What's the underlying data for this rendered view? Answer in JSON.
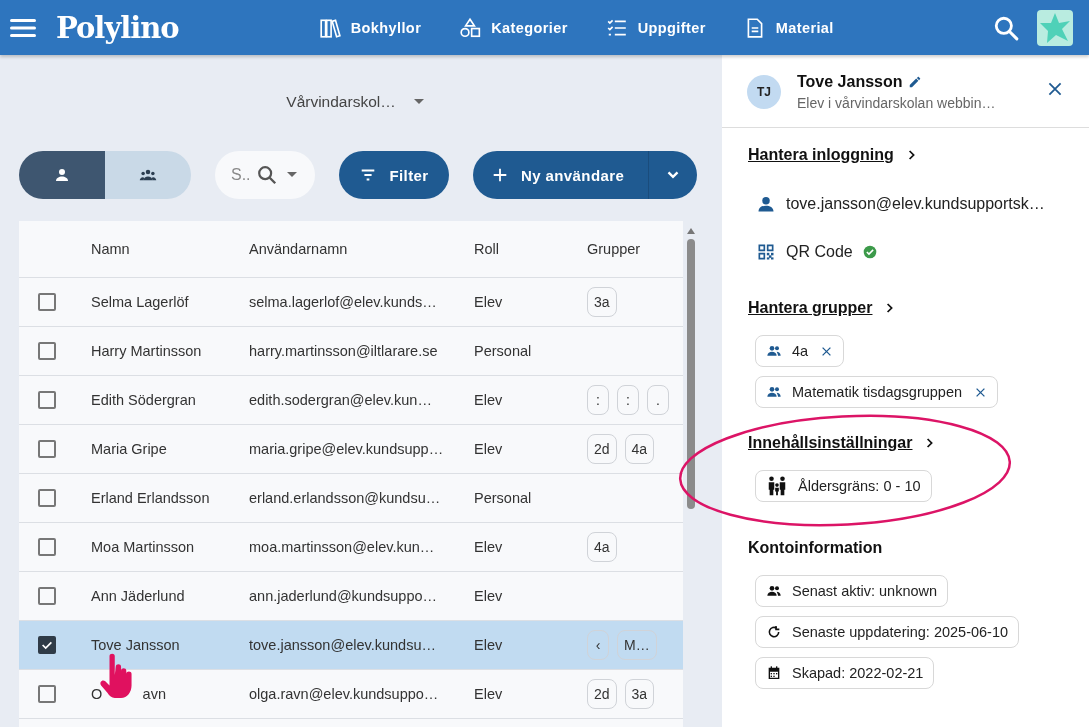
{
  "header": {
    "logo": "Polylino",
    "nav": [
      {
        "label": "Bokhyllor",
        "kind": "books"
      },
      {
        "label": "Kategorier",
        "kind": "shapes"
      },
      {
        "label": "Uppgifter",
        "kind": "checklist"
      },
      {
        "label": "Material",
        "kind": "document"
      }
    ]
  },
  "school_select": {
    "value": "Vårvindarskol…"
  },
  "view_toggle": [
    {
      "kind": "user",
      "selected": true
    },
    {
      "kind": "group",
      "selected": false
    }
  ],
  "search": {
    "placeholder": "S.."
  },
  "filter_button": "Filter",
  "new_user_button": "Ny användare",
  "table": {
    "columns": [
      "Namn",
      "Användarnamn",
      "Roll",
      "Grupper"
    ],
    "rows": [
      {
        "checked": false,
        "selected": false,
        "name": "Selma Lagerlöf",
        "username": "selma.lagerlof@elev.kunds…",
        "role": "Elev",
        "groups": [
          "3a"
        ]
      },
      {
        "checked": false,
        "selected": false,
        "name": "Harry Martinsson",
        "username": "harry.martinsson@iltlarare.se",
        "role": "Personal",
        "groups": []
      },
      {
        "checked": false,
        "selected": false,
        "name": "Edith Södergran",
        "username": "edith.sodergran@elev.kun…",
        "role": "Elev",
        "groups": [
          ":",
          ":",
          "."
        ]
      },
      {
        "checked": false,
        "selected": false,
        "name": "Maria Gripe",
        "username": "maria.gripe@elev.kundsupp…",
        "role": "Elev",
        "groups": [
          "2d",
          "4a"
        ]
      },
      {
        "checked": false,
        "selected": false,
        "name": "Erland Erlandsson",
        "username": "erland.erlandsson@kundsu…",
        "role": "Personal",
        "groups": []
      },
      {
        "checked": false,
        "selected": false,
        "name": "Moa Martinsson",
        "username": "moa.martinsson@elev.kun…",
        "role": "Elev",
        "groups": [
          "4a"
        ]
      },
      {
        "checked": false,
        "selected": false,
        "name": "Ann Jäderlund",
        "username": "ann.jaderlund@kundsuppo…",
        "role": "Elev",
        "groups": []
      },
      {
        "checked": true,
        "selected": true,
        "name": "Tove Jansson",
        "username": "tove.jansson@elev.kundsu…",
        "role": "Elev",
        "groups": [
          "‹",
          "M…"
        ]
      },
      {
        "checked": false,
        "selected": false,
        "name": "O          avn",
        "username": "olga.ravn@elev.kundsuppo…",
        "role": "Elev",
        "groups": [
          "2d",
          "3a"
        ]
      }
    ]
  },
  "panel": {
    "initials": "TJ",
    "name": "Tove Jansson",
    "subtitle": "Elev i vårvindarskolan webbin…",
    "login": {
      "heading": "Hantera inloggning",
      "username": "tove.jansson@elev.kundsupportsk…",
      "qr_label": "QR Code",
      "qr_verified": true
    },
    "groups": {
      "heading": "Hantera grupper",
      "chips": [
        "4a",
        "Matematik tisdagsgruppen"
      ]
    },
    "content": {
      "heading": "Innehållsinställningar",
      "chips": [
        "Åldersgräns: 0 - 10"
      ]
    },
    "account": {
      "heading": "Kontoinformation",
      "chips": [
        {
          "kind": "activity",
          "label": "Senast aktiv: unknown"
        },
        {
          "kind": "update",
          "label": "Senaste uppdatering: 2025-06-10"
        },
        {
          "kind": "created",
          "label": "Skapad: 2022-02-21"
        }
      ]
    }
  }
}
